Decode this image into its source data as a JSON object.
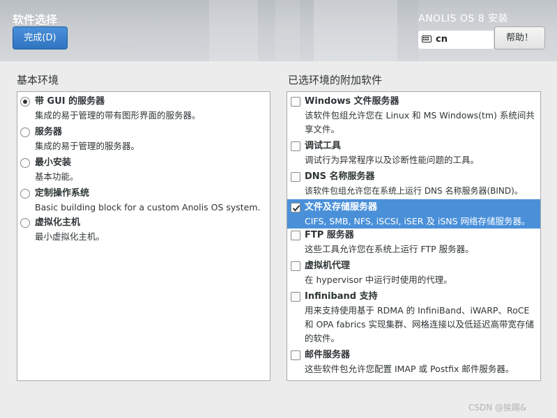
{
  "header": {
    "title": "软件选择",
    "done_label": "完成(D)",
    "product": "ANOLIS OS 8 安装",
    "keyboard_layout": "cn",
    "help_label": "帮助！"
  },
  "environments": {
    "title": "基本环境",
    "items": [
      {
        "name": "带 GUI 的服务器",
        "desc": "集成的易于管理的带有图形界面的服务器。",
        "selected": true
      },
      {
        "name": "服务器",
        "desc": "集成的易于管理的服务器。",
        "selected": false
      },
      {
        "name": "最小安装",
        "desc": "基本功能。",
        "selected": false
      },
      {
        "name": "定制操作系统",
        "desc": "Basic building block for a custom Anolis OS system.",
        "selected": false
      },
      {
        "name": "虚拟化主机",
        "desc": "最小虚拟化主机。",
        "selected": false
      }
    ]
  },
  "addons": {
    "title": "已选环境的附加软件",
    "items": [
      {
        "name": "Windows 文件服务器",
        "desc": "该软件包组允许您在 Linux 和 MS Windows(tm) 系统间共享文件。",
        "checked": false
      },
      {
        "name": "调试工具",
        "desc": "调试行为异常程序以及诊断性能问题的工具。",
        "checked": false
      },
      {
        "name": "DNS 名称服务器",
        "desc": "该软件包组允许您在系统上运行 DNS 名称服务器(BIND)。",
        "checked": false
      },
      {
        "name": "文件及存储服务器",
        "desc": "CIFS, SMB, NFS, iSCSI, iSER 及 iSNS 网络存储服务器。",
        "checked": true
      },
      {
        "name": "FTP 服务器",
        "desc": "这些工具允许您在系统上运行 FTP 服务器。",
        "checked": false
      },
      {
        "name": "虚拟机代理",
        "desc": "在 hypervisor 中运行时使用的代理。",
        "checked": false
      },
      {
        "name": "Infiniband 支持",
        "desc": "用来支持使用基于 RDMA 的 InfiniBand、iWARP、RoCE 和 OPA fabrics 实现集群、网格连接以及低延迟高带宽存储的软件。",
        "checked": false
      },
      {
        "name": "邮件服务器",
        "desc": "这些软件包允许您配置 IMAP 或 Postfix 邮件服务器。",
        "checked": false
      }
    ]
  },
  "watermark": "CSDN @挨踢&",
  "colors": {
    "accent": "#4a90d9",
    "done_button": "#3a83cf"
  }
}
